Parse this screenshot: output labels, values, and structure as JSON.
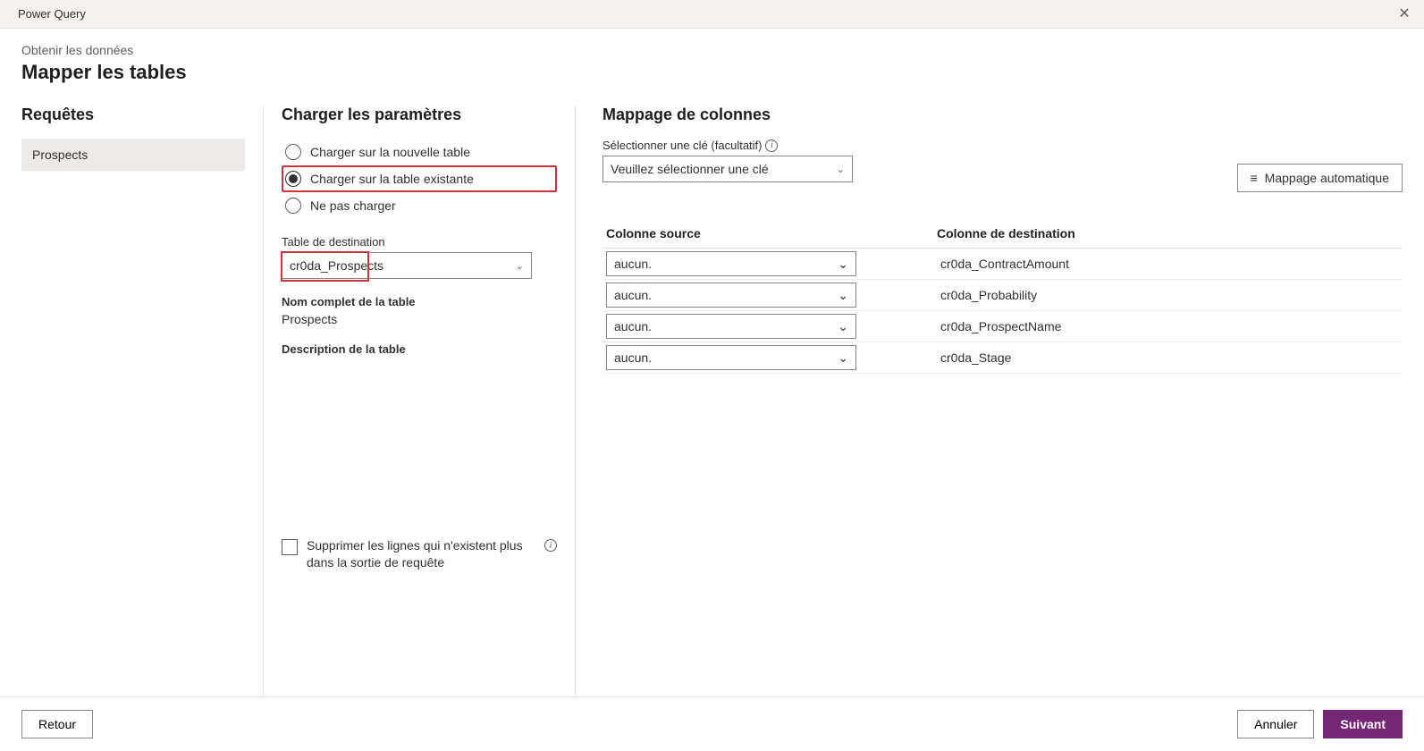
{
  "window": {
    "title": "Power Query"
  },
  "header": {
    "breadcrumb": "Obtenir les données",
    "title": "Mapper les tables"
  },
  "queries": {
    "heading": "Requêtes",
    "items": [
      {
        "label": "Prospects"
      }
    ]
  },
  "load": {
    "heading": "Charger les paramètres",
    "options": {
      "new_table": "Charger sur la nouvelle table",
      "existing_table": "Charger sur la table existante",
      "no_load": "Ne pas charger"
    },
    "selected_option": "existing_table",
    "dest_table_label": "Table de destination",
    "dest_table_value": "cr0da_Prospects",
    "full_name_label": "Nom complet de la table",
    "full_name_value": "Prospects",
    "desc_label": "Description de la table",
    "desc_value": "",
    "delete_label": "Supprimer les lignes qui n'existent plus dans la sortie de requête"
  },
  "mapping": {
    "heading": "Mappage de colonnes",
    "key_label": "Sélectionner une clé (facultatif)",
    "key_placeholder": "Veuillez sélectionner une clé",
    "auto_map_label": "Mappage automatique",
    "columns": {
      "source": "Colonne source",
      "dest": "Colonne de destination"
    },
    "none_text": "aucun.",
    "rows": [
      {
        "source": "aucun.",
        "dest": "cr0da_ContractAmount"
      },
      {
        "source": "aucun.",
        "dest": "cr0da_Probability"
      },
      {
        "source": "aucun.",
        "dest": "cr0da_ProspectName"
      },
      {
        "source": "aucun.",
        "dest": "cr0da_Stage"
      }
    ]
  },
  "footer": {
    "back": "Retour",
    "cancel": "Annuler",
    "next": "Suivant"
  }
}
